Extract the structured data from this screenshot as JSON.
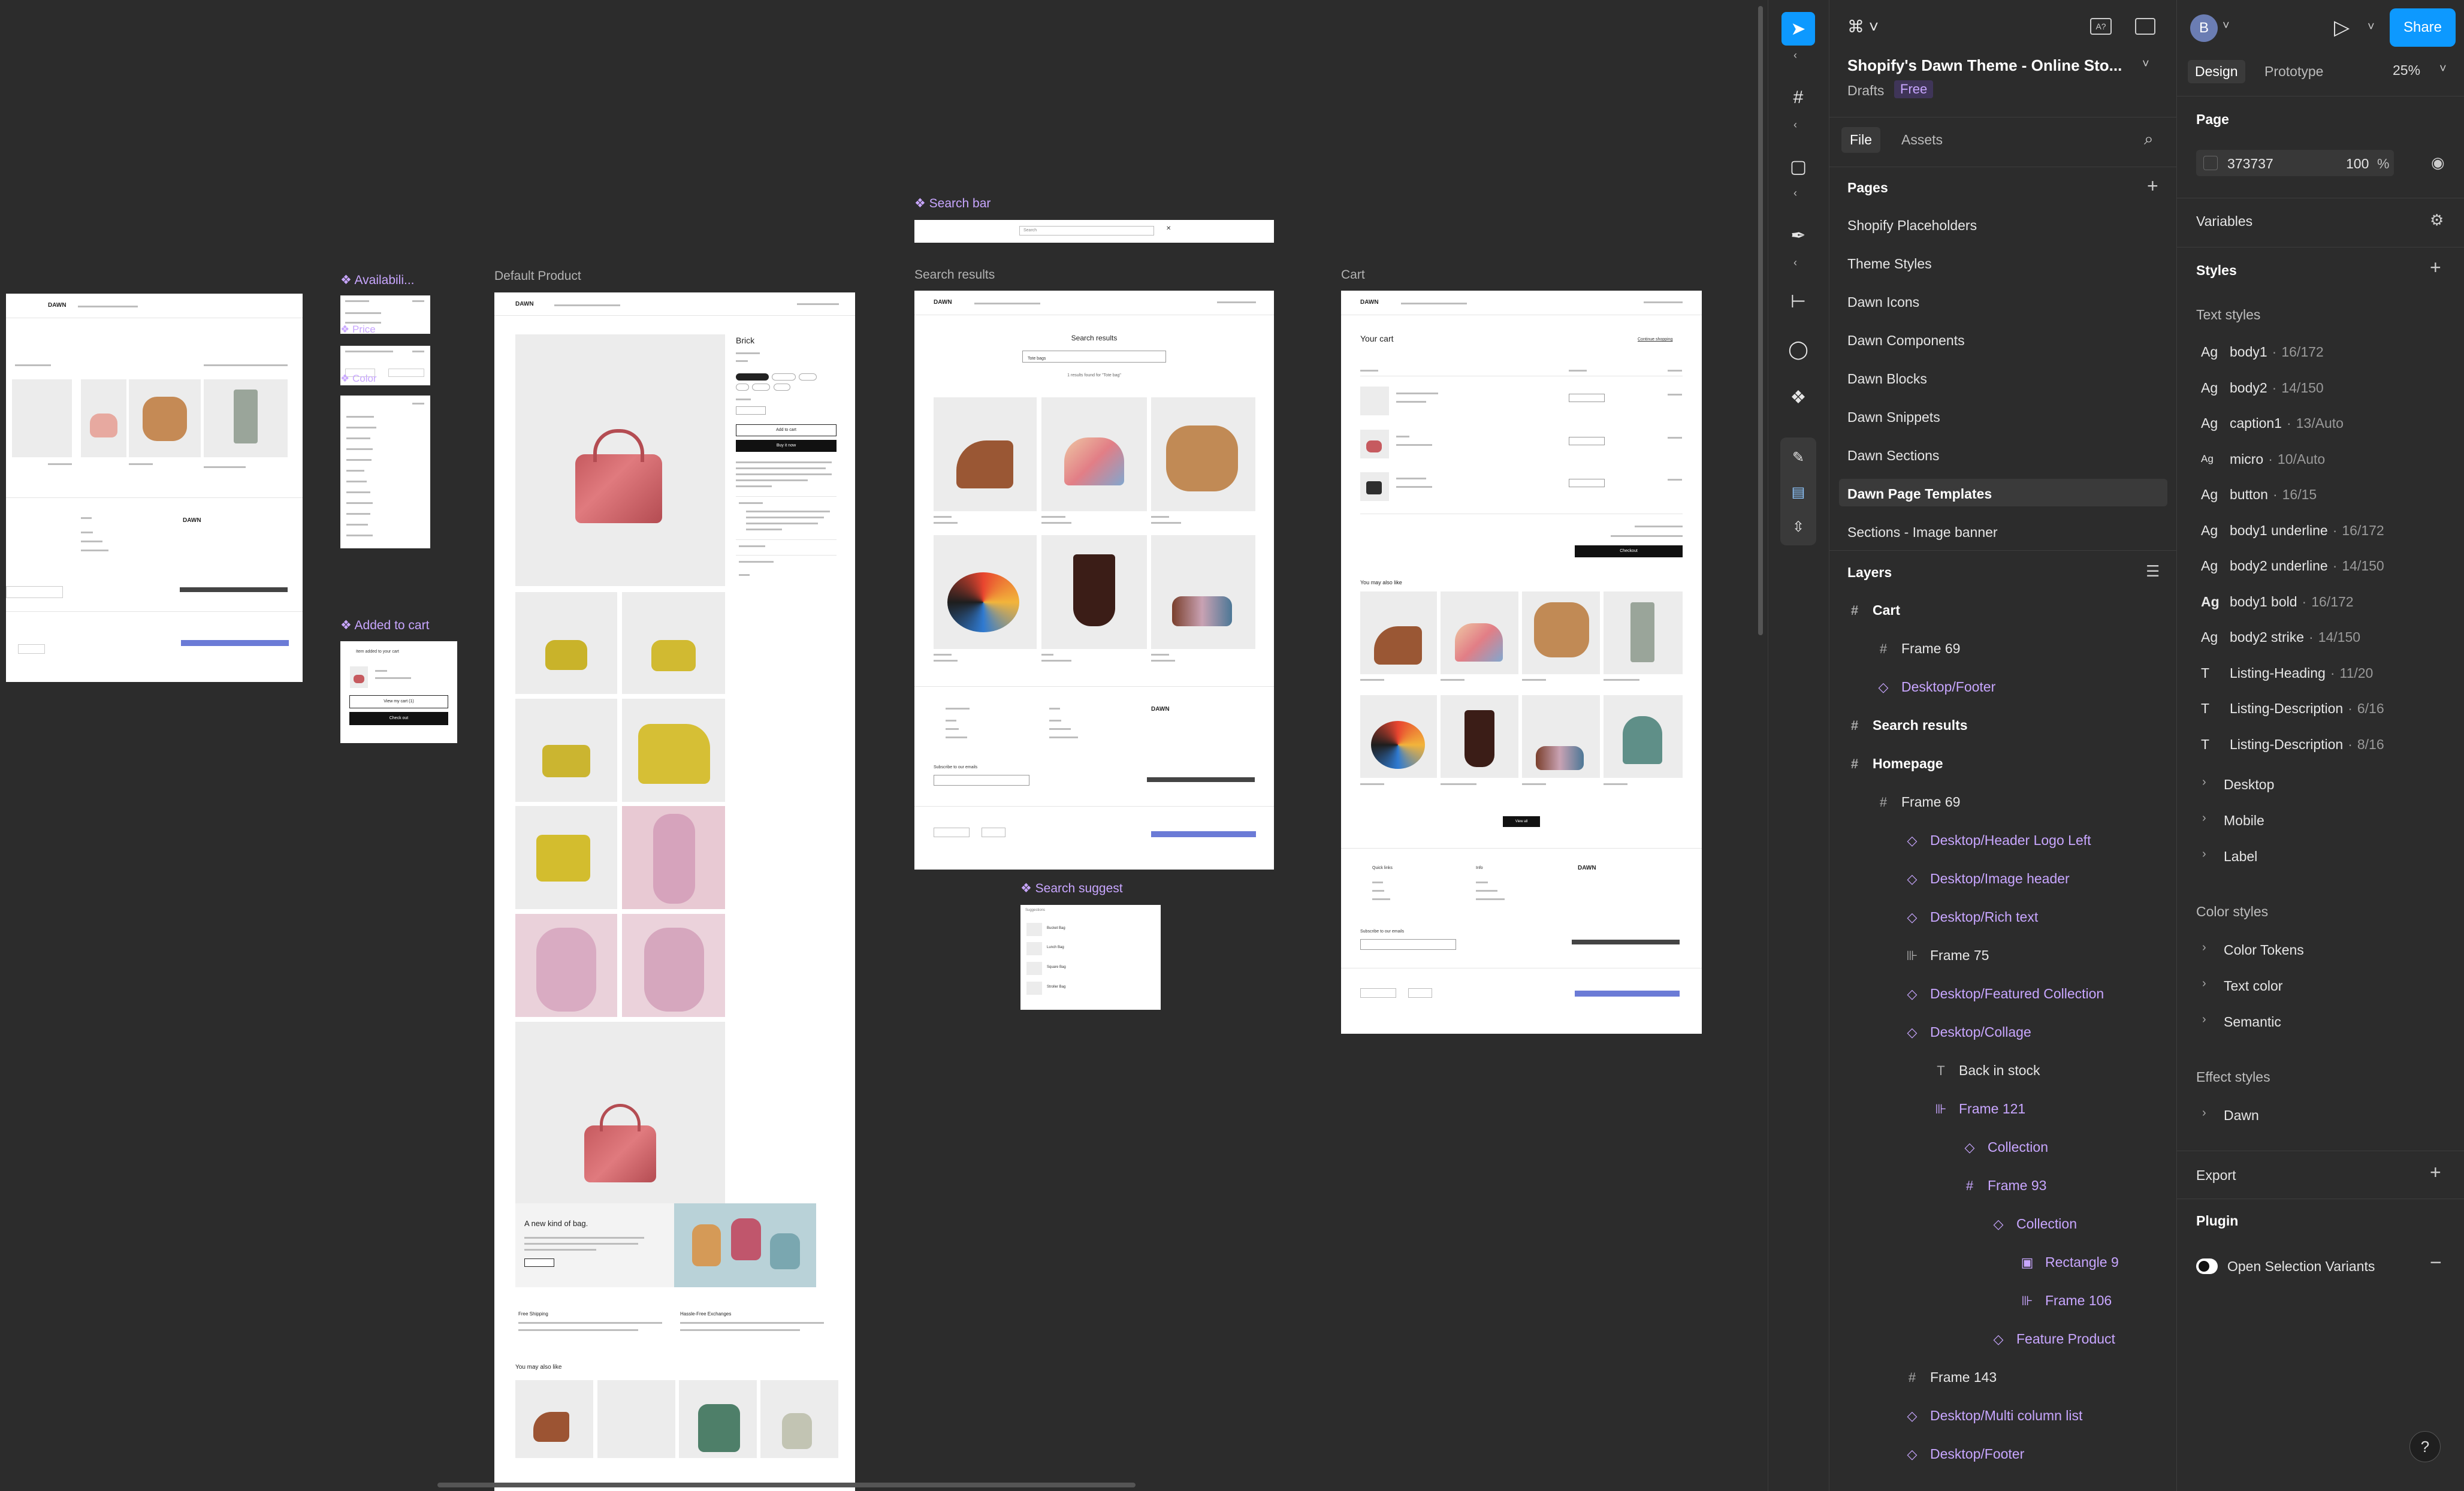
{
  "canvas": {
    "frames": {
      "availability": "Availabili...",
      "price": "Price",
      "color": "Color",
      "added_to_cart": "Added to cart",
      "default_product": "Default Product",
      "search_bar": "Search bar",
      "search_results": "Search results",
      "search_suggest": "Search suggest",
      "cart": "Cart"
    },
    "mock": {
      "brand": "DAWN",
      "product_title": "Brick",
      "add_to_cart": "Add to cart",
      "buy_it_now": "Buy it now",
      "new_kind_of_bag": "A new kind of bag.",
      "free_shipping": "Free Shipping",
      "hassle_free": "Hassle-Free Exchanges",
      "you_may_also_like": "You may also like",
      "search_results_title": "Search results",
      "search_query": "Tote bags",
      "results_count": "1 results found for \"Tote bag\"",
      "your_cart": "Your cart",
      "continue_shopping": "Continue shopping",
      "checkout": "Checkout",
      "quick_links": "Quick links",
      "info": "Info",
      "subscribe": "Subscribe to our emails",
      "view_all": "View all",
      "added_msg": "Item added to your cart",
      "view_my_cart": "View my cart (1)",
      "check_out": "Check out",
      "search_placeholder": "Search",
      "suggestions": "Suggestions",
      "product_item_1": "Bucket Bag",
      "product_item_2": "Lunch Bag",
      "product_item_3": "Square Bag",
      "product_item_4": "Stroller Bag"
    }
  },
  "left_panel": {
    "file_title": "Shopify's Dawn Theme - Online Sto...",
    "location": "Drafts",
    "badge": "Free",
    "tabs": [
      "File",
      "Assets"
    ],
    "pages_header": "Pages",
    "pages": [
      "Shopify Placeholders",
      "Theme Styles",
      "Dawn Icons",
      "Dawn Components",
      "Dawn Blocks",
      "Dawn Snippets",
      "Dawn Sections",
      "Dawn Page Templates",
      "Sections - Image banner"
    ],
    "selected_page": "Dawn Page Templates",
    "layers_header": "Layers",
    "layers": [
      {
        "name": "Cart",
        "kind": "frame-bold",
        "indent": 0
      },
      {
        "name": "Frame 69",
        "kind": "frame",
        "indent": 1
      },
      {
        "name": "Desktop/Footer",
        "kind": "instance",
        "indent": 1
      },
      {
        "name": "Search results",
        "kind": "frame-bold",
        "indent": 0
      },
      {
        "name": "Homepage",
        "kind": "frame-bold",
        "indent": 0
      },
      {
        "name": "Frame 69",
        "kind": "frame",
        "indent": 1
      },
      {
        "name": "Desktop/Header Logo Left",
        "kind": "instance",
        "indent": 2
      },
      {
        "name": "Desktop/Image header",
        "kind": "instance",
        "indent": 2
      },
      {
        "name": "Desktop/Rich text",
        "kind": "instance",
        "indent": 2
      },
      {
        "name": "Frame 75",
        "kind": "autolayout",
        "indent": 2
      },
      {
        "name": "Desktop/Featured Collection",
        "kind": "instance",
        "indent": 2
      },
      {
        "name": "Desktop/Collage",
        "kind": "instance",
        "indent": 2
      },
      {
        "name": "Back in stock",
        "kind": "text",
        "indent": 3
      },
      {
        "name": "Frame 121",
        "kind": "autolayout-comp",
        "indent": 3
      },
      {
        "name": "Collection",
        "kind": "instance",
        "indent": 4
      },
      {
        "name": "Frame 93",
        "kind": "frame-comp",
        "indent": 4
      },
      {
        "name": "Collection",
        "kind": "instance",
        "indent": 5
      },
      {
        "name": "Rectangle 9",
        "kind": "image-comp",
        "indent": 6
      },
      {
        "name": "Frame 106",
        "kind": "autolayout-comp",
        "indent": 6
      },
      {
        "name": "Feature Product",
        "kind": "instance",
        "indent": 5
      },
      {
        "name": "Frame 143",
        "kind": "frame",
        "indent": 2
      },
      {
        "name": "Desktop/Multi column list",
        "kind": "instance",
        "indent": 2
      },
      {
        "name": "Desktop/Footer",
        "kind": "instance",
        "indent": 2
      }
    ]
  },
  "right_panel": {
    "avatar": "B",
    "share": "Share",
    "tabs": [
      "Design",
      "Prototype"
    ],
    "zoom": "25%",
    "page_header": "Page",
    "page_color": "373737",
    "page_opacity": "100",
    "page_opacity_unit": "%",
    "variables": "Variables",
    "styles": "Styles",
    "text_styles_header": "Text styles",
    "text_styles": [
      {
        "icon": "Ag",
        "name": "body1",
        "meta": "16/172"
      },
      {
        "icon": "Ag",
        "name": "body2",
        "meta": "14/150"
      },
      {
        "icon": "Ag",
        "name": "caption1",
        "meta": "13/Auto"
      },
      {
        "icon": "Ag",
        "name": "micro",
        "meta": "10/Auto"
      },
      {
        "icon": "Ag",
        "name": "button",
        "meta": "16/15"
      },
      {
        "icon": "Ag",
        "name": "body1 underline",
        "meta": "16/172"
      },
      {
        "icon": "Ag",
        "name": "body2 underline",
        "meta": "14/150"
      },
      {
        "icon": "Ag",
        "name": "body1 bold",
        "meta": "16/172"
      },
      {
        "icon": "Ag",
        "name": "body2 strike",
        "meta": "14/150"
      },
      {
        "icon": "T",
        "name": "Listing-Heading",
        "meta": "11/20"
      },
      {
        "icon": "T",
        "name": "Listing-Description",
        "meta": "6/16"
      },
      {
        "icon": "T",
        "name": "Listing-Description",
        "meta": "8/16"
      }
    ],
    "text_groups": [
      "Desktop",
      "Mobile",
      "Label"
    ],
    "color_styles_header": "Color styles",
    "color_groups": [
      "Color Tokens",
      "Text color",
      "Semantic"
    ],
    "effect_styles_header": "Effect styles",
    "effect_groups": [
      "Dawn"
    ],
    "export": "Export",
    "plugin": "Plugin",
    "plugin_item": "Open Selection Variants",
    "help": "?"
  },
  "colors": {
    "accent": "#0d99ff",
    "component": "#c8a6ff",
    "panel": "#2c2c2c"
  }
}
